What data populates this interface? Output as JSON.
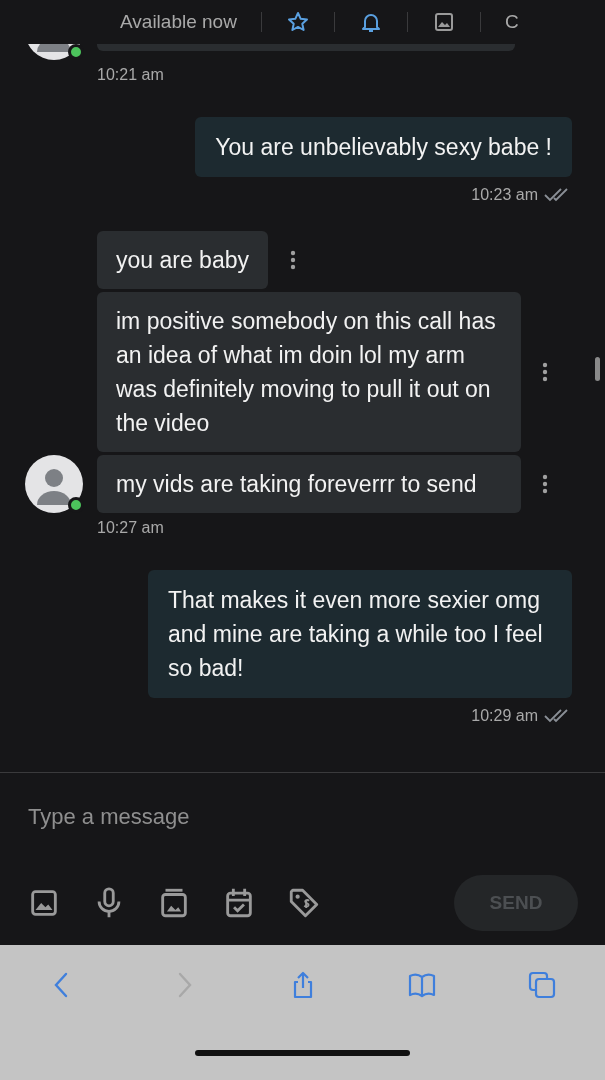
{
  "header": {
    "status_text": "Available now",
    "items": [
      {
        "kind": "star"
      },
      {
        "kind": "bell"
      },
      {
        "kind": "image"
      }
    ],
    "trailing_text": "C"
  },
  "top_avatar": {
    "online": true
  },
  "groups": [
    {
      "kind": "received",
      "time": "10:21 am"
    },
    {
      "kind": "sent",
      "bubbles": [
        {
          "text": "You are unbelievably sexy babe !"
        }
      ],
      "time": "10:23 am",
      "read": true
    },
    {
      "kind": "received",
      "bubbles": [
        {
          "text": "you are baby"
        },
        {
          "text": "im positive somebody on this call has an idea of what im doin lol my arm was definitely moving to pull it out on the video"
        },
        {
          "text": "my vids are taking foreverrr to send"
        }
      ],
      "time": "10:27 am",
      "online": true
    },
    {
      "kind": "sent",
      "bubbles": [
        {
          "text": "That makes it even more sexier omg and mine are taking a while too I feel so bad!"
        }
      ],
      "time": "10:29 am",
      "read": true
    }
  ],
  "composer": {
    "placeholder": "Type a message",
    "tools": [
      {
        "kind": "image"
      },
      {
        "kind": "mic"
      },
      {
        "kind": "gallery"
      },
      {
        "kind": "calendar"
      },
      {
        "kind": "price"
      }
    ],
    "send": {
      "label": "SEND",
      "disabled": true
    }
  },
  "browser_toolbar": [
    {
      "kind": "back",
      "disabled": false
    },
    {
      "kind": "forward",
      "disabled": true
    },
    {
      "kind": "share",
      "disabled": false
    },
    {
      "kind": "bookmarks",
      "disabled": false
    },
    {
      "kind": "tabs",
      "disabled": false
    }
  ]
}
